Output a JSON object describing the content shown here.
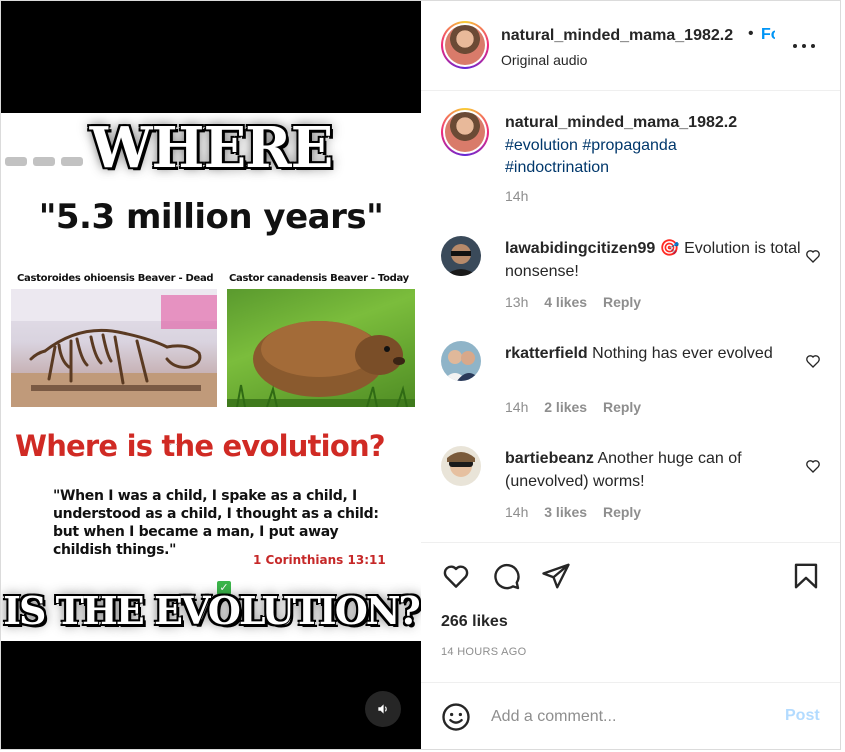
{
  "post": {
    "media": {
      "overlay_top": "WHERE",
      "overlay_bottom": "IS THE EVOLUTION?",
      "headline": "\"5.3 million years\"",
      "caption_left": "Castoroides ohioensis Beaver - Dead",
      "caption_right": "Castor canadensis Beaver - Today",
      "question": "Where is the evolution?",
      "quote": "\"When I was a child, I spake as a child, I understood as a child, I thought as a child: but when I became a man, I put away childish things.\"",
      "verse": "1 Corinthians 13:11",
      "audio_icon": "speaker-icon"
    },
    "header": {
      "username": "natural_minded_mama_1982.2",
      "dot": "•",
      "follow_label": "Fo",
      "subtitle": "Original audio",
      "more_icon": "more-horizontal-icon"
    },
    "caption": {
      "username": "natural_minded_mama_1982.2",
      "hashtags": [
        "#evolution",
        "#propaganda",
        "#indoctrination"
      ],
      "time": "14h"
    },
    "comments": [
      {
        "username": "lawabidingcitizen99",
        "emoji": "🎯",
        "text": "Evolution is total nonsense!",
        "time": "13h",
        "likes": "4 likes",
        "reply": "Reply"
      },
      {
        "username": "rkatterfield",
        "emoji": "",
        "text": "Nothing has ever evolved",
        "time": "14h",
        "likes": "2 likes",
        "reply": "Reply"
      },
      {
        "username": "bartiebeanz",
        "emoji": "",
        "text": "Another huge can of (unevolved) worms!",
        "time": "14h",
        "likes": "3 likes",
        "reply": "Reply"
      }
    ],
    "actions": {
      "likes": "266 likes",
      "time_ago": "14 HOURS AGO",
      "icons": [
        "heart-icon",
        "comment-icon",
        "share-icon",
        "bookmark-icon"
      ]
    },
    "add_comment": {
      "placeholder": "Add a comment...",
      "post_label": "Post",
      "emoji_icon": "emoji-icon"
    },
    "colors": {
      "link_blue": "#0095f6",
      "hashtag": "#00376b",
      "muted": "#8e8e8e",
      "headline_red": "#d02a24",
      "post_disabled": "#b3dbff"
    }
  }
}
